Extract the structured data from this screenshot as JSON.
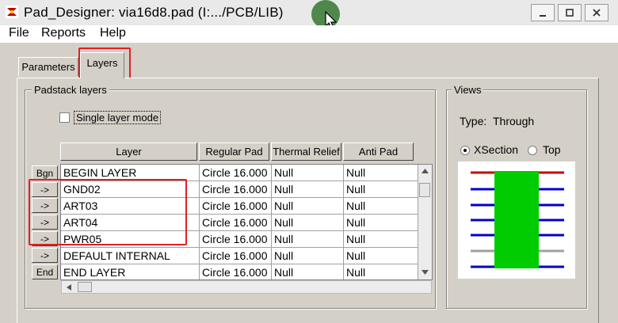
{
  "window": {
    "title": "Pad_Designer: via16d8.pad (I:.../PCB/LIB)",
    "minimize_label": "_",
    "maximize_label": "□",
    "close_label": "✕"
  },
  "menu": {
    "items": [
      {
        "label": "File"
      },
      {
        "label": "Reports"
      },
      {
        "label": "Help"
      }
    ]
  },
  "tabs": [
    {
      "label": "Parameters",
      "selected": false
    },
    {
      "label": "Layers",
      "selected": true
    }
  ],
  "padstack": {
    "group_label": "Padstack layers",
    "single_layer_mode_label": "Single layer mode",
    "single_layer_mode_checked": false,
    "columns": [
      "Layer",
      "Regular Pad",
      "Thermal Relief",
      "Anti Pad"
    ],
    "rows": [
      {
        "button": "Bgn",
        "layer": "BEGIN LAYER",
        "regular": "Circle 16.000",
        "thermal": "Null",
        "anti": "Null"
      },
      {
        "button": "->",
        "layer": "GND02",
        "regular": "Circle 16.000",
        "thermal": "Null",
        "anti": "Null"
      },
      {
        "button": "->",
        "layer": "ART03",
        "regular": "Circle 16.000",
        "thermal": "Null",
        "anti": "Null"
      },
      {
        "button": "->",
        "layer": "ART04",
        "regular": "Circle 16.000",
        "thermal": "Null",
        "anti": "Null"
      },
      {
        "button": "->",
        "layer": "PWR05",
        "regular": "Circle 16.000",
        "thermal": "Null",
        "anti": "Null"
      },
      {
        "button": "->",
        "layer": "DEFAULT INTERNAL",
        "regular": "Circle 16.000",
        "thermal": "Null",
        "anti": "Null"
      },
      {
        "button": "End",
        "layer": "END LAYER",
        "regular": "Circle 16.000",
        "thermal": "Null",
        "anti": "Null"
      }
    ]
  },
  "views": {
    "group_label": "Views",
    "type_label": "Type:",
    "type_value": "Through",
    "xsection_label": "XSection",
    "top_label": "Top",
    "selected": "XSection",
    "colors": {
      "pad": "#00cc00",
      "top_layer": "#cc0000",
      "inner_layer": "#0000cc",
      "default_internal": "#a0a0a0"
    }
  }
}
